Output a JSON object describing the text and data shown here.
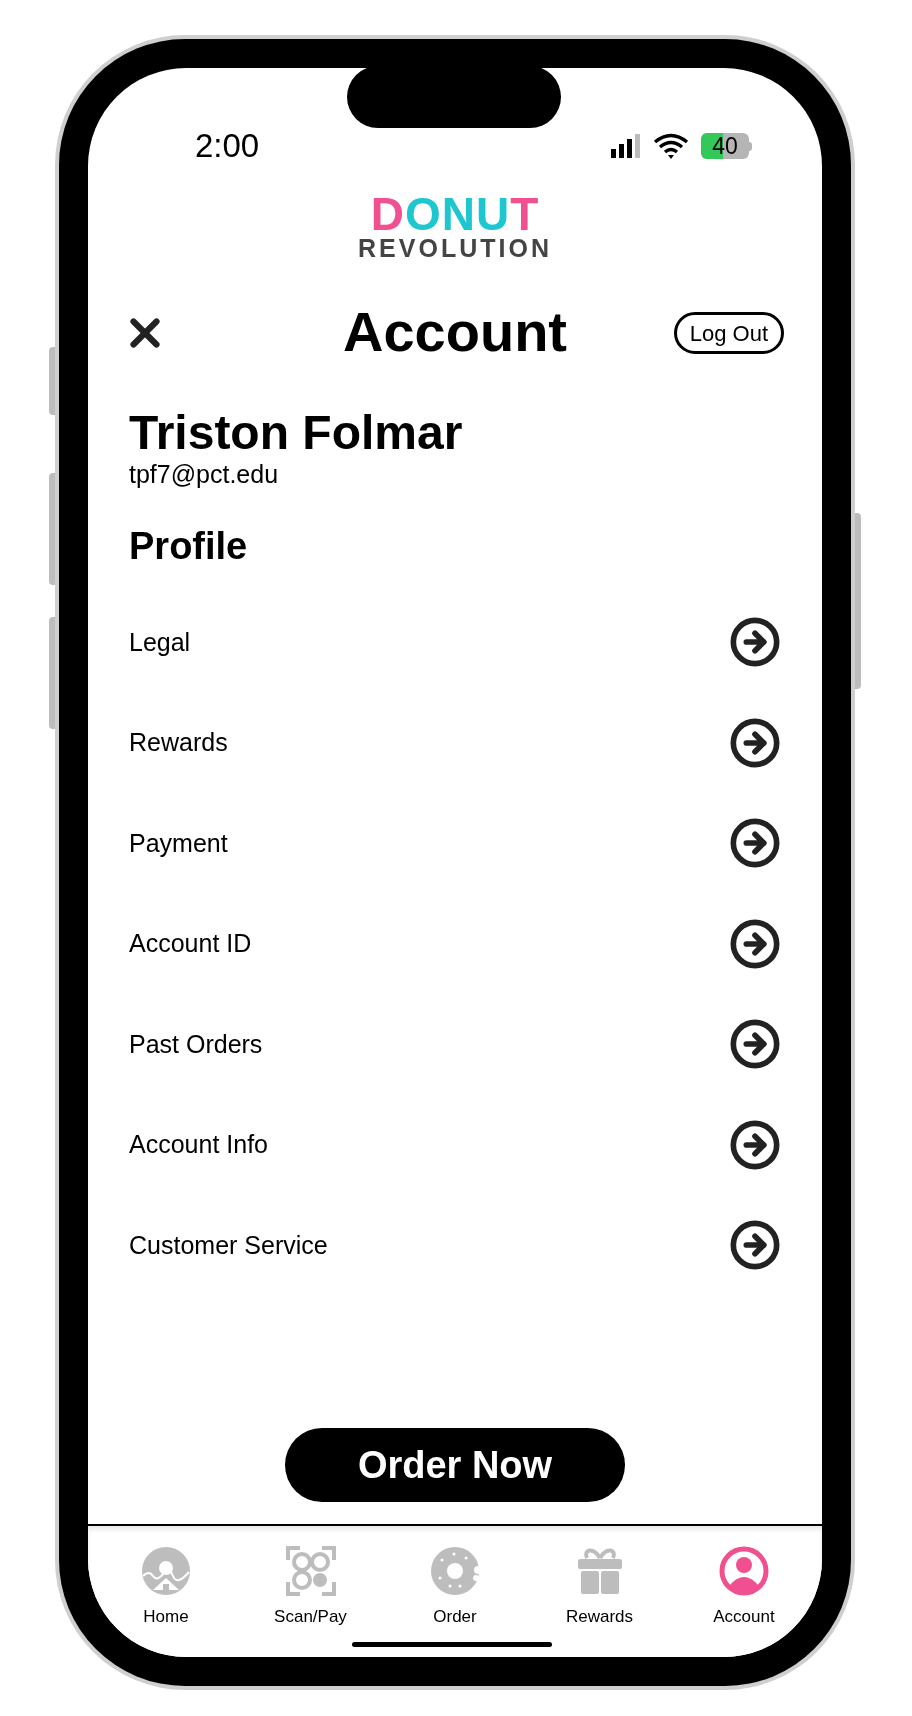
{
  "status_bar": {
    "time": "2:00",
    "battery": "40"
  },
  "logo": {
    "top": "DONUT",
    "bottom": "REVOLUTION"
  },
  "header": {
    "title": "Account",
    "logout": "Log Out"
  },
  "user": {
    "name": "Triston Folmar",
    "email": "tpf7@pct.edu"
  },
  "section_title": "Profile",
  "menu_items": [
    {
      "label": "Legal"
    },
    {
      "label": "Rewards"
    },
    {
      "label": "Payment"
    },
    {
      "label": "Account ID"
    },
    {
      "label": "Past Orders"
    },
    {
      "label": "Account Info"
    },
    {
      "label": "Customer Service"
    }
  ],
  "order_button": "Order Now",
  "tab_bar": [
    {
      "kind": "home",
      "label": "Home",
      "selected": false
    },
    {
      "kind": "scan",
      "label": "Scan/Pay",
      "selected": false
    },
    {
      "kind": "donut",
      "label": "Order",
      "selected": false
    },
    {
      "kind": "gift",
      "label": "Rewards",
      "selected": false
    },
    {
      "kind": "account",
      "label": "Account",
      "selected": true
    }
  ]
}
